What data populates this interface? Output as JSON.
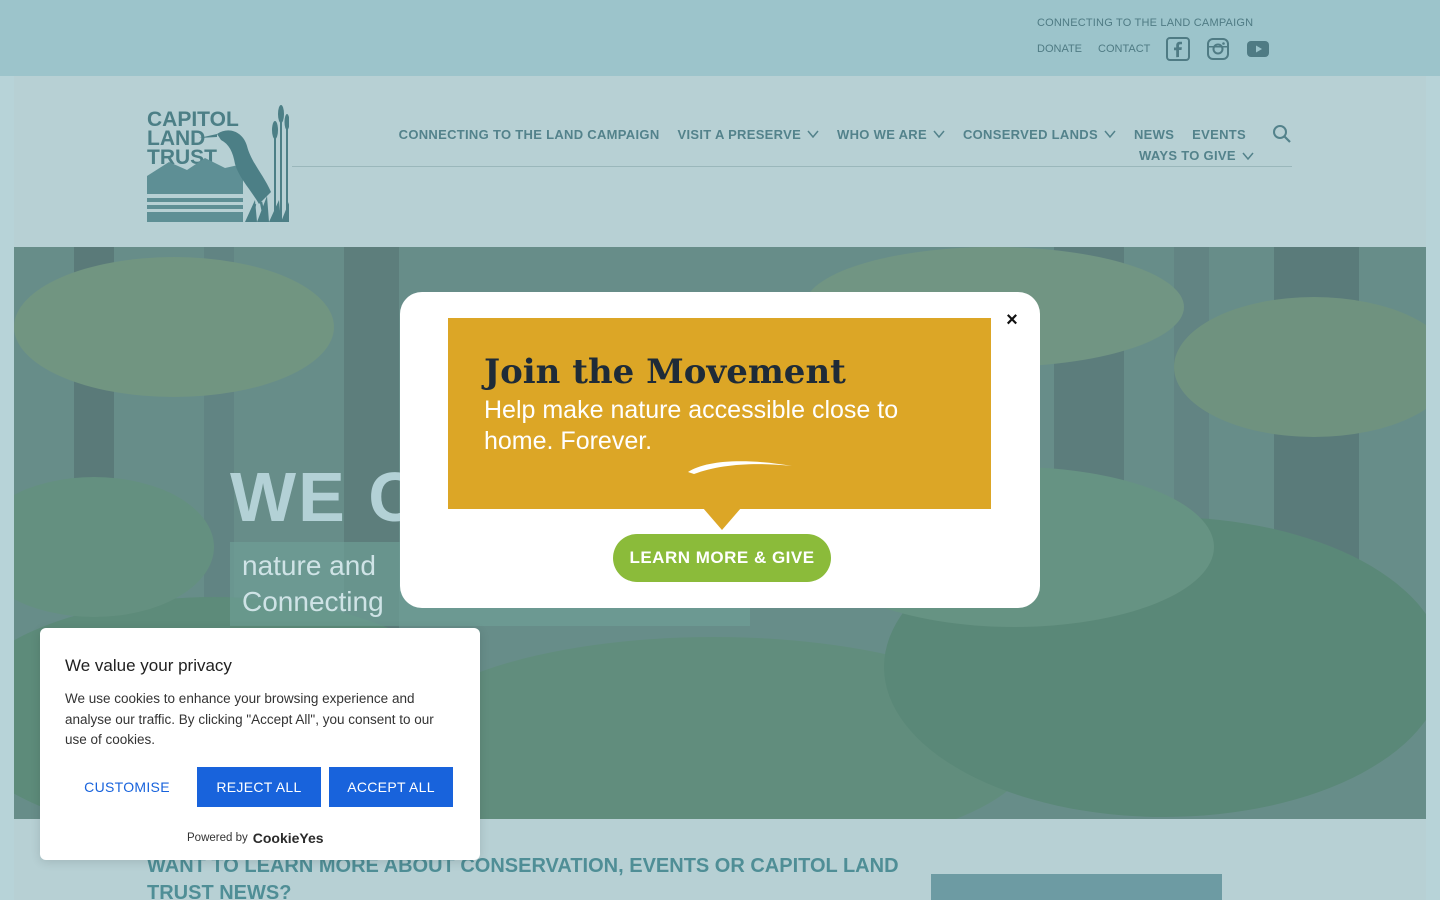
{
  "topbar": {
    "campaign_link": "CONNECTING TO THE LAND CAMPAIGN",
    "donate": "DONATE",
    "contact": "CONTACT",
    "social": [
      "facebook-icon",
      "instagram-icon",
      "youtube-icon"
    ]
  },
  "header": {
    "logo_text": [
      "CAPITOL",
      "LAND",
      "TRUST"
    ],
    "nav": [
      {
        "label": "CONNECTING TO THE LAND CAMPAIGN",
        "dropdown": false
      },
      {
        "label": "VISIT A PRESERVE",
        "dropdown": true
      },
      {
        "label": "WHO WE ARE",
        "dropdown": true
      },
      {
        "label": "CONSERVED LANDS",
        "dropdown": true
      },
      {
        "label": "NEWS",
        "dropdown": false
      },
      {
        "label": "EVENTS",
        "dropdown": false
      }
    ],
    "nav_row2": {
      "label": "WAYS TO GIVE",
      "dropdown": true
    },
    "search_icon": "search-icon"
  },
  "hero": {
    "title_visible": "WE C",
    "subtitle_line1": "nature and",
    "subtitle_line2": "Connecting"
  },
  "modal": {
    "title": "Join the Movement",
    "subtitle": "Help make nature accessible close to home. Forever.",
    "button": "LEARN MORE & GIVE",
    "close": "×"
  },
  "cookie": {
    "title": "We value your privacy",
    "text": "We use cookies to enhance your browsing experience and analyse our traffic. By clicking \"Accept All\", you consent to our use of cookies.",
    "customise": "CUSTOMISE",
    "reject": "REJECT ALL",
    "accept": "ACCEPT ALL",
    "powered_by": "Powered by",
    "powered_logo": "CookieYes"
  },
  "bottom": {
    "heading": "WANT TO LEARN MORE ABOUT CONSERVATION, EVENTS OR CAPITOL LAND TRUST NEWS?"
  },
  "colors": {
    "topbar": "#9cc4cb",
    "header": "#b7d0d4",
    "promo_gold": "#dca626",
    "promo_green": "#8bbb3a",
    "cookie_blue": "#1863dc"
  }
}
